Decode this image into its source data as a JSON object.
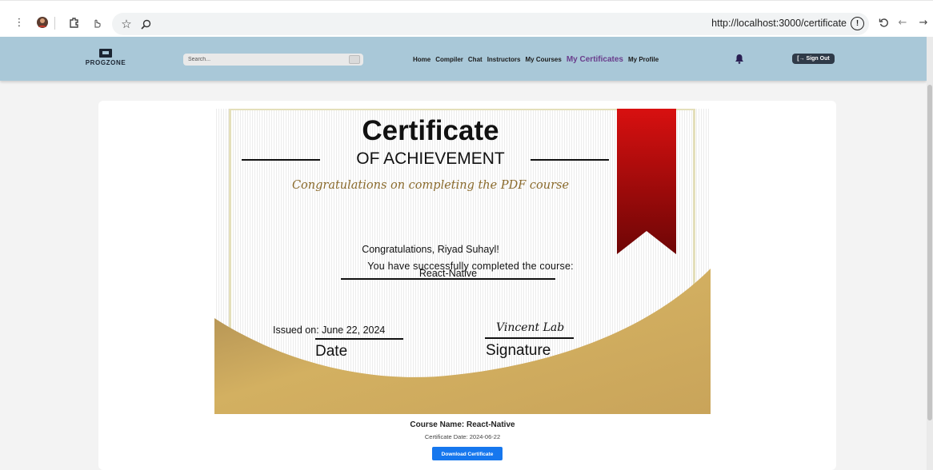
{
  "browser": {
    "url": "http://localhost:3000/certificate"
  },
  "header": {
    "logo_text": "PROGZONE",
    "search_placeholder": "Search...",
    "nav": [
      {
        "label": "Home"
      },
      {
        "label": "Compiler"
      },
      {
        "label": "Chat"
      },
      {
        "label": "Instructors"
      },
      {
        "label": "My Courses"
      },
      {
        "label": "My Certificates",
        "active": true
      },
      {
        "label": "My Profile"
      }
    ],
    "signout_label": "[→ Sign Out"
  },
  "certificate": {
    "title": "Certificate",
    "subtitle": "OF ACHIEVEMENT",
    "script_line": "Congratulations on completing the PDF course",
    "greeting": "Congratulations, Riyad Suhayl!",
    "completed_text": "You have successfully completed the course:",
    "course": "React-Native",
    "issued": "Issued on: June 22, 2024",
    "date_label": "Date",
    "signatory": "Vincent Lab",
    "signature_label": "Signature"
  },
  "details": {
    "course_name": "Course Name: React-Native",
    "certificate_date": "Certificate Date: 2024-06-22",
    "download_label": "Download Certificate"
  },
  "colors": {
    "header_bg": "#a9c8d8",
    "active_nav": "#6a3d8c",
    "gold": "#c9a45a",
    "ribbon": "#c60d0d",
    "download_btn": "#1677ee"
  }
}
